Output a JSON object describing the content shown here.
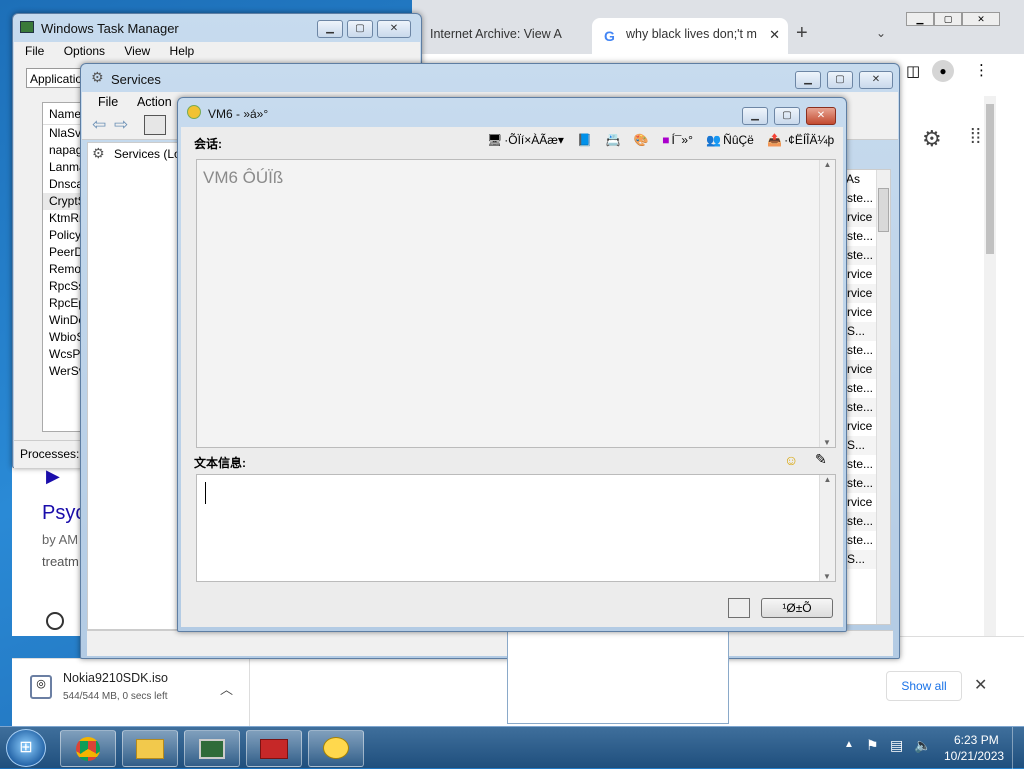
{
  "chrome": {
    "tabs": [
      {
        "title": "Internet Archive: View A"
      },
      {
        "title": "why black lives don;'t m"
      }
    ],
    "new_tab": "+",
    "download": {
      "filename": "Nokia9210SDK.iso",
      "status": "544/544 MB, 0 secs left",
      "show_all": "Show all"
    },
    "page_snippet": {
      "title": "Psyc",
      "byline": "by AM",
      "line3": "treatm"
    }
  },
  "task_manager": {
    "title": "Windows Task Manager",
    "menu": [
      "File",
      "Options",
      "View",
      "Help"
    ],
    "tab": "Applicatio",
    "col_name": "Name",
    "rows": [
      "NlaSvc",
      "napage",
      "Lanma",
      "Dnscac",
      "CryptS",
      "KtmRm",
      "PolicyA",
      "PeerDi",
      "Remot",
      "RpcSs",
      "RpcEpt",
      "WinDe",
      "WbioSr",
      "WcsPlu",
      "WerSv"
    ],
    "status": "Processes: 4"
  },
  "services": {
    "title": "Services",
    "menu": [
      "File",
      "Action"
    ],
    "tree_item": "Services (Lo",
    "col_header": "As",
    "right_rows": [
      "ste...",
      "rvice",
      "ste...",
      "ste...",
      "rvice",
      "rvice",
      "rvice",
      "S...",
      "ste...",
      "rvice",
      "ste...",
      "ste...",
      "rvice",
      "S...",
      "ste...",
      "ste...",
      "rvice",
      "ste...",
      "ste...",
      "S..."
    ]
  },
  "chat": {
    "title": "VM6 - »á»°",
    "session_label": "会话:",
    "toolbar": [
      "·ÕÏí×ÀÃæ▾",
      "Í¯»°",
      "ÑûÇë",
      "·¢ËÍÎÄ¼þ"
    ],
    "placeholder_text": "VM6 ÔÚÏß",
    "text_label": "文本信息:",
    "send_button": "¹Ø±Õ"
  },
  "taskbar": {
    "time": "6:23 PM",
    "date": "10/21/2023"
  }
}
